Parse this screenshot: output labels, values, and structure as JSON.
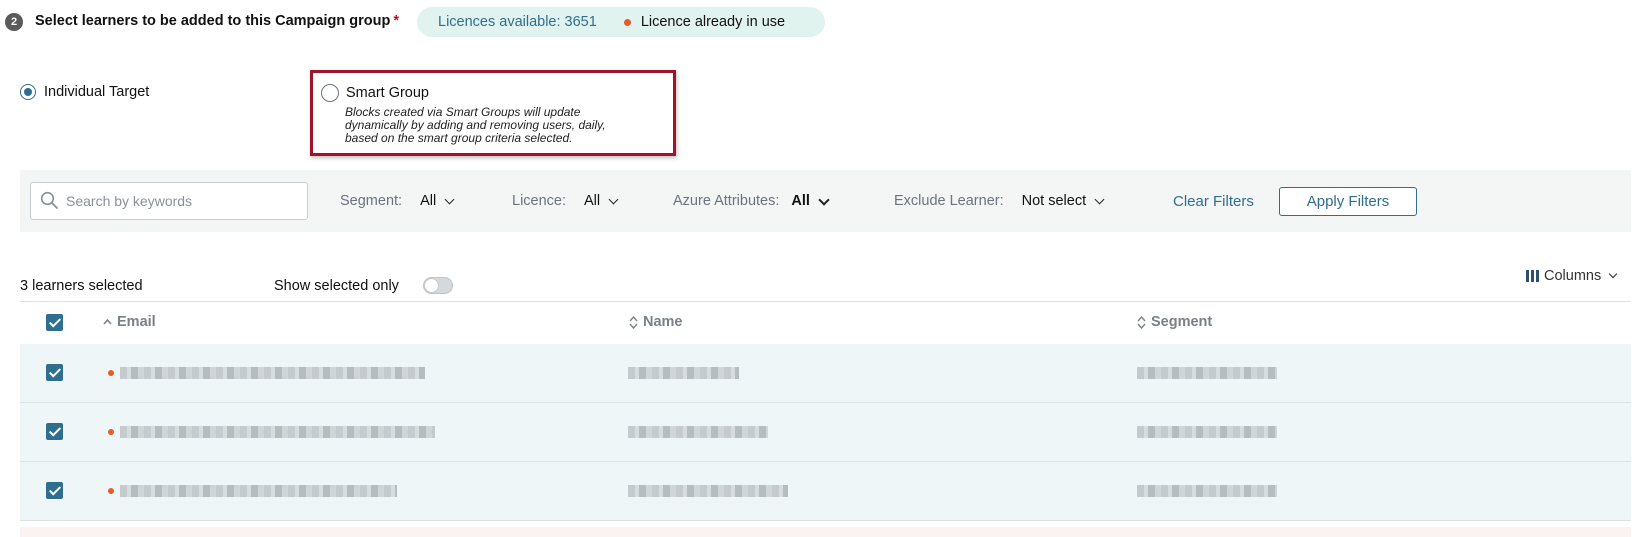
{
  "step": {
    "number": "2",
    "title": "Select learners to be added to this Campaign group",
    "required_marker": "*"
  },
  "licence": {
    "available_label": "Licences available: 3651",
    "in_use_label": "Licence already in use",
    "in_use_color": "#e8592c"
  },
  "target": {
    "individual_label": "Individual Target",
    "individual_selected": true,
    "smart_label": "Smart Group",
    "smart_selected": false,
    "smart_description_lines": [
      "Blocks created via Smart Groups will update",
      "dynamically by adding and removing users, daily,",
      "based on the smart group criteria selected."
    ]
  },
  "filters": {
    "search_placeholder": "Search by keywords",
    "segment": {
      "label": "Segment:",
      "value": "All"
    },
    "licence": {
      "label": "Licence:",
      "value": "All"
    },
    "azure": {
      "label": "Azure Attributes:",
      "value": "All"
    },
    "exclude": {
      "label": "Exclude Learner:",
      "value": "Not select"
    },
    "clear_label": "Clear Filters",
    "apply_label": "Apply Filters"
  },
  "selection": {
    "count_label": "3 learners selected",
    "show_selected_label": "Show selected only",
    "show_selected_on": false,
    "columns_label": "Columns"
  },
  "table": {
    "headers": {
      "email": "Email",
      "name": "Name",
      "segment": "Segment"
    },
    "header_checked": true,
    "rows_checked": [
      true,
      true,
      true
    ]
  },
  "colors": {
    "accent": "#2f6e8e",
    "highlight_border": "#a0142a",
    "licence_pill": "#e1f3ef"
  }
}
